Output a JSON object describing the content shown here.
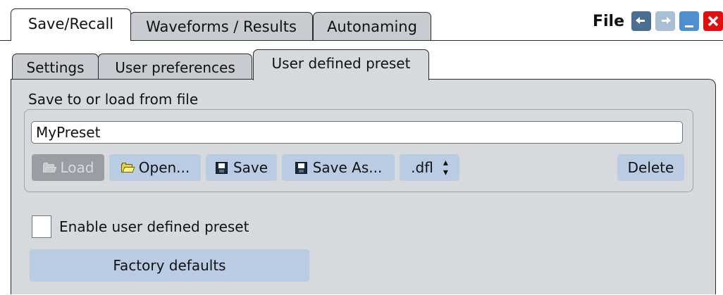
{
  "window": {
    "title": "File",
    "controls": [
      "undo-icon",
      "redo-icon",
      "minimize-icon",
      "close-icon"
    ]
  },
  "top_tabs": [
    {
      "label": "Save/Recall",
      "active": true
    },
    {
      "label": "Waveforms / Results",
      "active": false
    },
    {
      "label": "Autonaming",
      "active": false
    }
  ],
  "sub_tabs": [
    {
      "label": "Settings",
      "active": false
    },
    {
      "label": "User preferences",
      "active": false
    },
    {
      "label": "User defined preset",
      "active": true
    }
  ],
  "file_group": {
    "label": "Save to or load from file",
    "file_name": "MyPreset",
    "buttons": {
      "load": "Load",
      "open": "Open...",
      "save": "Save",
      "save_as": "Save As...",
      "extension": ".dfl",
      "delete": "Delete"
    }
  },
  "enable_preset": {
    "label": "Enable user defined preset",
    "checked": false
  },
  "factory_defaults_label": "Factory defaults",
  "colors": {
    "button": "#b9cce3",
    "panel": "#d7dadd",
    "tab_inactive": "#c8ccd1",
    "close": "#e01010",
    "minimize": "#4f8fd0"
  }
}
